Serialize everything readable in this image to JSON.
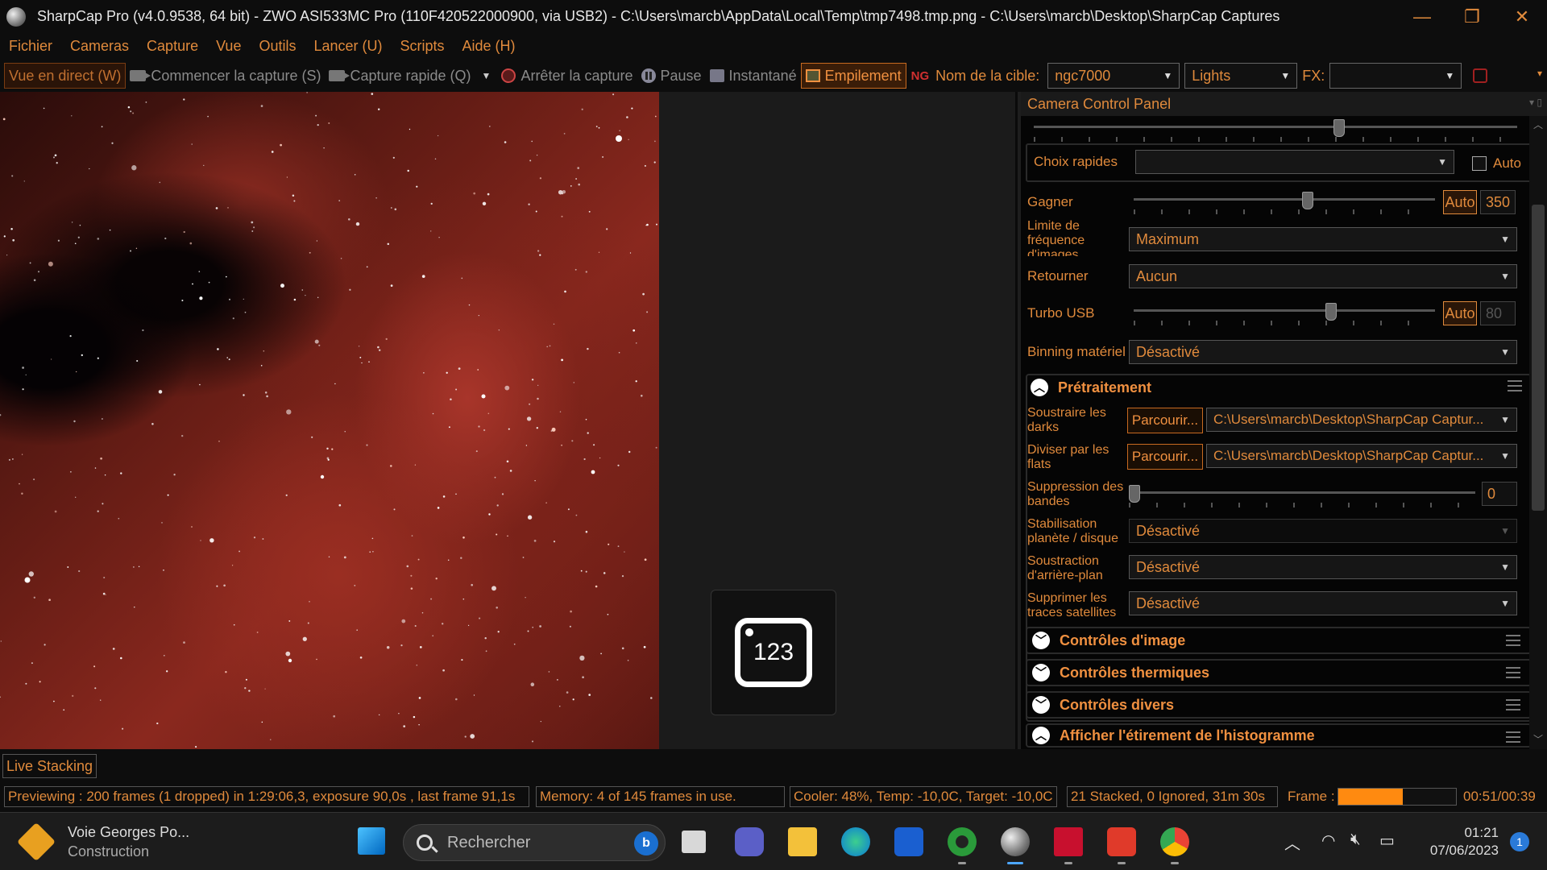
{
  "window": {
    "title": "SharpCap Pro (v4.0.9538, 64 bit) - ZWO ASI533MC Pro (110F420522000900, via USB2) - C:\\Users\\marcb\\AppData\\Local\\Temp\\tmp7498.tmp.png - C:\\Users\\marcb\\Desktop\\SharpCap Captures",
    "minimize": "—",
    "maximize": "❐",
    "close": "✕"
  },
  "menu": [
    "Fichier",
    "Cameras",
    "Capture",
    "Vue",
    "Outils",
    "Lancer (U)",
    "Scripts",
    "Aide (H)"
  ],
  "toolbar": {
    "live_view": "Vue en direct (W)",
    "start_capture": "Commencer la capture (S)",
    "quick_capture": "Capture rapide (Q)",
    "stop_capture": "Arrêter la capture",
    "pause": "Pause",
    "snapshot": "Instantané",
    "stacking": "Empilement",
    "ng_icon": "NG",
    "target_label": "Nom de la cible:",
    "target_value": "ngc7000",
    "frame_type": "Lights",
    "fx_label": "FX:",
    "fx_value": ""
  },
  "counter_widget": {
    "text": "123"
  },
  "panel": {
    "title": "Camera Control Panel",
    "quick_choice_label": "Choix rapides",
    "quick_choice_value": "",
    "auto_check_label": "Auto",
    "gain": {
      "label": "Gagner",
      "auto": "Auto",
      "value": "350",
      "position": 0.58
    },
    "frame_rate": {
      "label": "Limite de fréquence d'images",
      "value": "Maximum"
    },
    "flip": {
      "label": "Retourner",
      "value": "Aucun"
    },
    "usb_turbo": {
      "label": "Turbo USB",
      "auto": "Auto",
      "value": "80",
      "position": 0.66
    },
    "binning": {
      "label": "Binning matériel",
      "value": "Désactivé"
    },
    "preprocessing": {
      "title": "Prétraitement",
      "darks": {
        "label": "Soustraire les darks",
        "button": "Parcourir...",
        "path": "C:\\Users\\marcb\\Desktop\\SharpCap Captur..."
      },
      "flats": {
        "label": "Diviser par les flats",
        "button": "Parcourir...",
        "path": "C:\\Users\\marcb\\Desktop\\SharpCap Captur..."
      },
      "banding": {
        "label": "Suppression des bandes",
        "value": "0",
        "position": 0.0
      },
      "stabilization": {
        "label": "Stabilisation planète / disque",
        "value": "Désactivé"
      },
      "background": {
        "label": "Soustraction d'arrière-plan",
        "value": "Désactivé"
      },
      "satellites": {
        "label": "Supprimer les traces satellites",
        "value": "Désactivé"
      }
    },
    "sections": [
      "Contrôles d'image",
      "Contrôles thermiques",
      "Contrôles divers",
      "Afficher l'étirement de l'histogramme"
    ]
  },
  "bottom_tab": "Live Stacking",
  "status": {
    "preview": "Previewing : 200 frames (1 dropped) in 1:29:06,3, exposure 90,0s , last frame 91,1s",
    "memory": "Memory: 4 of 145 frames in use.",
    "cooler": "Cooler: 48%, Temp: -10,0C, Target: -10,0C",
    "stacked": "21 Stacked, 0 Ignored, 31m 30s",
    "frame_label": "Frame :",
    "frame_progress": 0.55,
    "frame_time": "00:51/00:39"
  },
  "taskbar": {
    "weather_title": "Voie Georges Po...",
    "weather_sub": "Construction",
    "search_placeholder": "Rechercher",
    "bing": "b",
    "time": "01:21",
    "date": "07/06/2023",
    "notifications": "1"
  },
  "colors": {
    "accent": "#e08a3c",
    "background": "#0d0d0d",
    "progress": "#ff8a10"
  }
}
